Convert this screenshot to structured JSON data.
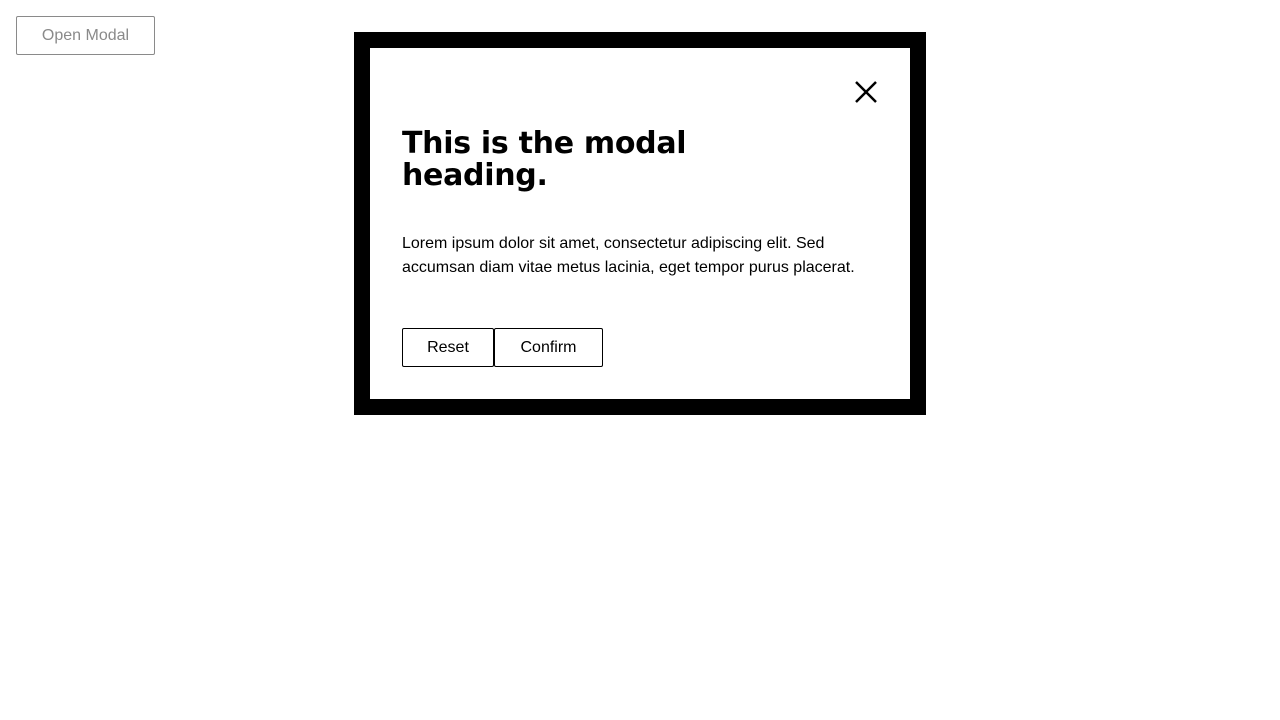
{
  "page": {
    "open_modal_label": "Open Modal"
  },
  "modal": {
    "close_icon": "close-icon",
    "heading": "This is the modal heading.",
    "body": "Lorem ipsum dolor sit amet, consectetur adipiscing elit. Sed accumsan diam vitae metus lacinia, eget tempor purus placerat.",
    "actions": {
      "reset_label": "Reset",
      "confirm_label": "Confirm"
    }
  },
  "colors": {
    "frame": "#000000",
    "background": "#ffffff",
    "muted_text": "#8a8a8a",
    "text": "#000000"
  }
}
